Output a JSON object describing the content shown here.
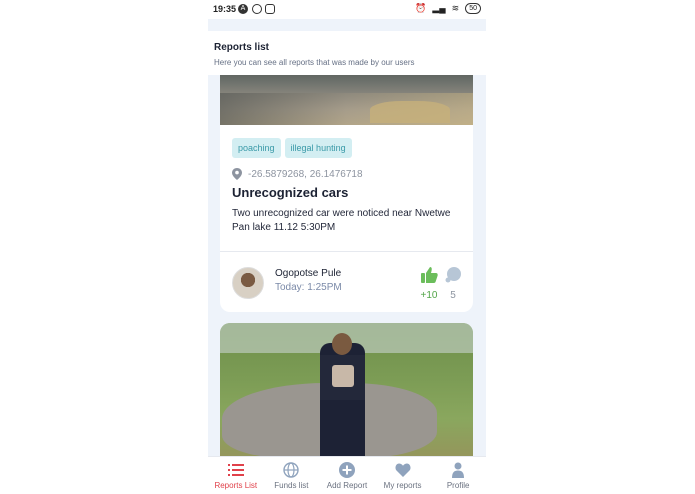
{
  "status_bar": {
    "time": "19:35",
    "battery": "50"
  },
  "header": {
    "title": "Reports list",
    "subtitle": "Here you can see all reports that was made by our users"
  },
  "report": {
    "tags": [
      "poaching",
      "illegal hunting"
    ],
    "coordinates": "-26.5879268, 26.1476718",
    "title": "Unrecognized cars",
    "description": "Two unrecognized car were noticed near Nwetwe Pan lake  11.12 5:30PM",
    "author": "Ogopotse Pule",
    "time": "Today: 1:25PM",
    "likes": "+10",
    "comments": "5"
  },
  "nav": {
    "items": [
      {
        "label": "Reports List",
        "icon": "list-icon",
        "active": true
      },
      {
        "label": "Funds list",
        "icon": "globe-icon",
        "active": false
      },
      {
        "label": "Add Report",
        "icon": "plus-circle-icon",
        "active": false
      },
      {
        "label": "My reports",
        "icon": "heart-icon",
        "active": false
      },
      {
        "label": "Profile",
        "icon": "person-icon",
        "active": false
      }
    ]
  },
  "colors": {
    "accent": "#e0414a",
    "tag_bg": "#d3eef2",
    "tag_text": "#3a9aa8",
    "like": "#52a548",
    "background": "#eef3fa"
  }
}
